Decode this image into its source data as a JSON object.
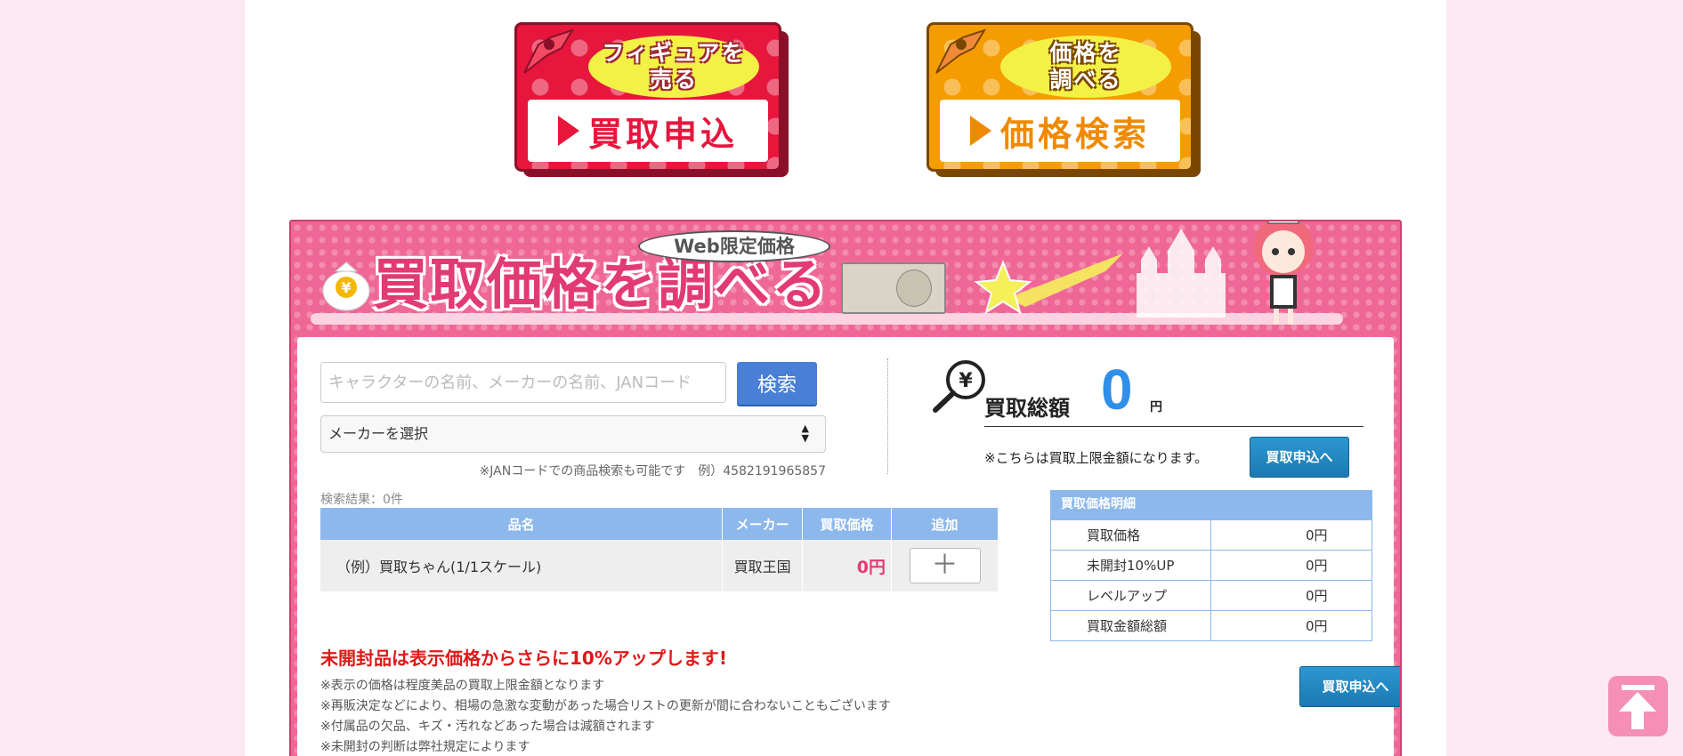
{
  "top_buttons": {
    "sell": {
      "caption": "フィギュアを\n売る",
      "label": "買取申込"
    },
    "price": {
      "caption": "価格を\n調べる",
      "label": "価格検索"
    }
  },
  "header": {
    "title": "買取価格を調べる",
    "badge": "Web限定価格",
    "yen_sign": "¥"
  },
  "search": {
    "placeholder": "キャラクターの名前、メーカーの名前、JANコード",
    "button": "検索",
    "maker_select": "メーカーを選択",
    "jan_note": "※JANコードでの商品検索も可能です　例）4582191965857"
  },
  "summary": {
    "yen_icon": "¥",
    "label": "買取総額",
    "value": "0",
    "unit": "円",
    "note": "※こちらは買取上限金額になります。",
    "apply_button": "買取申込へ"
  },
  "results": {
    "count": "検索結果：0件",
    "headers": [
      "品名",
      "メーカー",
      "買取価格",
      "追加"
    ],
    "rows": [
      {
        "name": "（例）買取ちゃん(1/1スケール)",
        "maker": "買取王国",
        "price": "0円",
        "add": "＋"
      }
    ]
  },
  "detail": {
    "title": "買取価格明細",
    "rows": [
      {
        "label": "買取価格",
        "value": "0円"
      },
      {
        "label": "未開封10%UP",
        "value": "0円"
      },
      {
        "label": "レベルアップ",
        "value": "0円"
      },
      {
        "label": "買取金額総額",
        "value": "0円"
      }
    ],
    "apply_button": "買取申込へ"
  },
  "promo": "未開封品は表示価格からさらに10%アップします!",
  "notes": [
    "※表示の価格は程度美品の買取上限金額となります",
    "※再販決定などにより、相場の急激な変動があった場合リストの更新が間に合わないこともございます",
    "※付属品の欠品、キズ・汚れなどあった場合は減額されます",
    "※未開封の判断は弊社規定によります"
  ],
  "colors": {
    "pink": "#ef6796",
    "red_button": "#e6163d",
    "orange_button": "#f59c00",
    "blue": "#8cb8ec",
    "total_value": "#2f8fea",
    "promo": "#e01818"
  }
}
